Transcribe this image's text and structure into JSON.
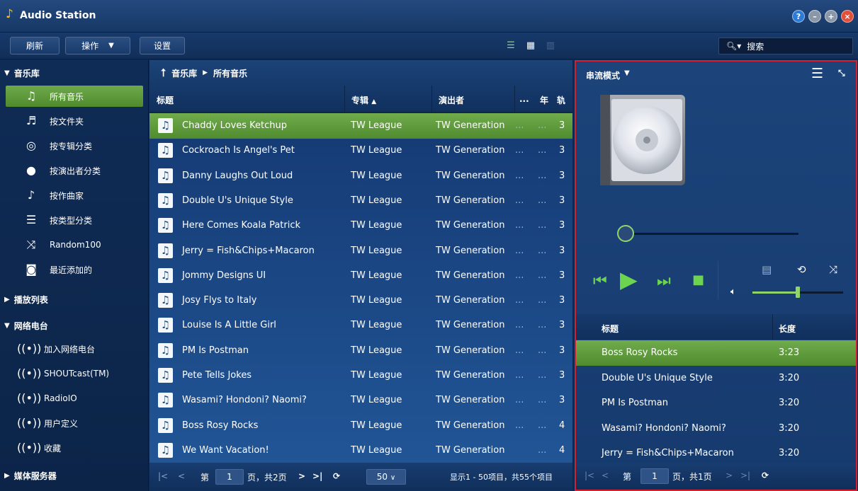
{
  "window": {
    "title": "Audio Station",
    "buttons": [
      "?",
      "–",
      "+",
      "×"
    ]
  },
  "toolbar": {
    "refresh": "刷新",
    "action": "操作",
    "settings": "设置",
    "search_placeholder": "搜索"
  },
  "sidebar": {
    "library_header": "音乐库",
    "library_items": [
      {
        "label": "所有音乐",
        "icon": "music-note-icon",
        "active": true
      },
      {
        "label": "按文件夹",
        "icon": "folder-music-icon"
      },
      {
        "label": "按专辑分类",
        "icon": "disc-icon"
      },
      {
        "label": "按演出者分类",
        "icon": "person-icon"
      },
      {
        "label": "按作曲家",
        "icon": "composer-icon"
      },
      {
        "label": "按类型分类",
        "icon": "list-icon"
      },
      {
        "label": "Random100",
        "icon": "shuffle-icon"
      },
      {
        "label": "最近添加的",
        "icon": "recent-icon"
      }
    ],
    "playlist_header": "播放列表",
    "radio_header": "网络电台",
    "radio_items": [
      {
        "label": "加入网络电台"
      },
      {
        "label": "SHOUTcast(TM)"
      },
      {
        "label": "RadioIO"
      },
      {
        "label": "用户定义"
      },
      {
        "label": "收藏"
      }
    ],
    "media_header": "媒体服务器"
  },
  "breadcrumb": {
    "root": "音乐库",
    "current": "所有音乐"
  },
  "track_table": {
    "columns": {
      "title": "标题",
      "album": "专辑",
      "artist": "演出者",
      "more": "...",
      "year": "年",
      "track": "轨"
    },
    "rows": [
      {
        "title": "Chaddy Loves Ketchup",
        "album": "TW League",
        "artist": "TW Generation",
        "extra": "...",
        "year": "...",
        "track": "3",
        "selected": true
      },
      {
        "title": "Cockroach Is Angel's Pet",
        "album": "TW League",
        "artist": "TW Generation",
        "extra": "...",
        "year": "...",
        "track": "3"
      },
      {
        "title": "Danny Laughs Out Loud",
        "album": "TW League",
        "artist": "TW Generation",
        "extra": "...",
        "year": "...",
        "track": "3"
      },
      {
        "title": "Double U's Unique Style",
        "album": "TW League",
        "artist": "TW Generation",
        "extra": "...",
        "year": "...",
        "track": "3"
      },
      {
        "title": "Here Comes Koala Patrick",
        "album": "TW League",
        "artist": "TW Generation",
        "extra": "...",
        "year": "...",
        "track": "3"
      },
      {
        "title": "Jerry = Fish&Chips+Macaron",
        "album": "TW League",
        "artist": "TW Generation",
        "extra": "...",
        "year": "...",
        "track": "3"
      },
      {
        "title": "Jommy Designs UI",
        "album": "TW League",
        "artist": "TW Generation",
        "extra": "...",
        "year": "...",
        "track": "3"
      },
      {
        "title": "Josy Flys to Italy",
        "album": "TW League",
        "artist": "TW Generation",
        "extra": "...",
        "year": "...",
        "track": "3"
      },
      {
        "title": "Louise Is A Little Girl",
        "album": "TW League",
        "artist": "TW Generation",
        "extra": "...",
        "year": "...",
        "track": "3"
      },
      {
        "title": "PM Is Postman",
        "album": "TW League",
        "artist": "TW Generation",
        "extra": "...",
        "year": "...",
        "track": "3"
      },
      {
        "title": "Pete Tells Jokes",
        "album": "TW League",
        "artist": "TW Generation",
        "extra": "...",
        "year": "...",
        "track": "3"
      },
      {
        "title": "Wasami? Hondoni? Naomi?",
        "album": "TW League",
        "artist": "TW Generation",
        "extra": "...",
        "year": "...",
        "track": "3"
      },
      {
        "title": "Boss Rosy Rocks",
        "album": "TW League",
        "artist": "TW Generation",
        "extra": "...",
        "year": "...",
        "track": "4"
      },
      {
        "title": "We Want Vacation!",
        "album": "TW League",
        "artist": "TW Generation",
        "extra": "",
        "year": "...",
        "track": "4"
      }
    ]
  },
  "pager": {
    "page_prefix": "第",
    "page": "1",
    "page_suffix": "页，共2页",
    "page_size": "50",
    "summary": "显示1 - 50项目，共55个项目"
  },
  "player": {
    "mode_label": "串流模式",
    "queue_columns": {
      "title": "标题",
      "length": "长度"
    },
    "queue": [
      {
        "title": "Boss Rosy Rocks",
        "length": "3:23",
        "selected": true
      },
      {
        "title": "Double U's Unique Style",
        "length": "3:20"
      },
      {
        "title": "PM Is Postman",
        "length": "3:20"
      },
      {
        "title": "Wasami? Hondoni? Naomi?",
        "length": "3:20"
      },
      {
        "title": "Jerry = Fish&Chips+Macaron",
        "length": "3:20"
      }
    ],
    "volume": 0.5,
    "progress": 0.0,
    "pager": {
      "page_prefix": "第",
      "page": "1",
      "page_suffix": "页，共1页"
    }
  },
  "colors": {
    "accent_green": "#5f9c3c",
    "border_red": "#d4202d",
    "background_blue": "#1c4478"
  }
}
